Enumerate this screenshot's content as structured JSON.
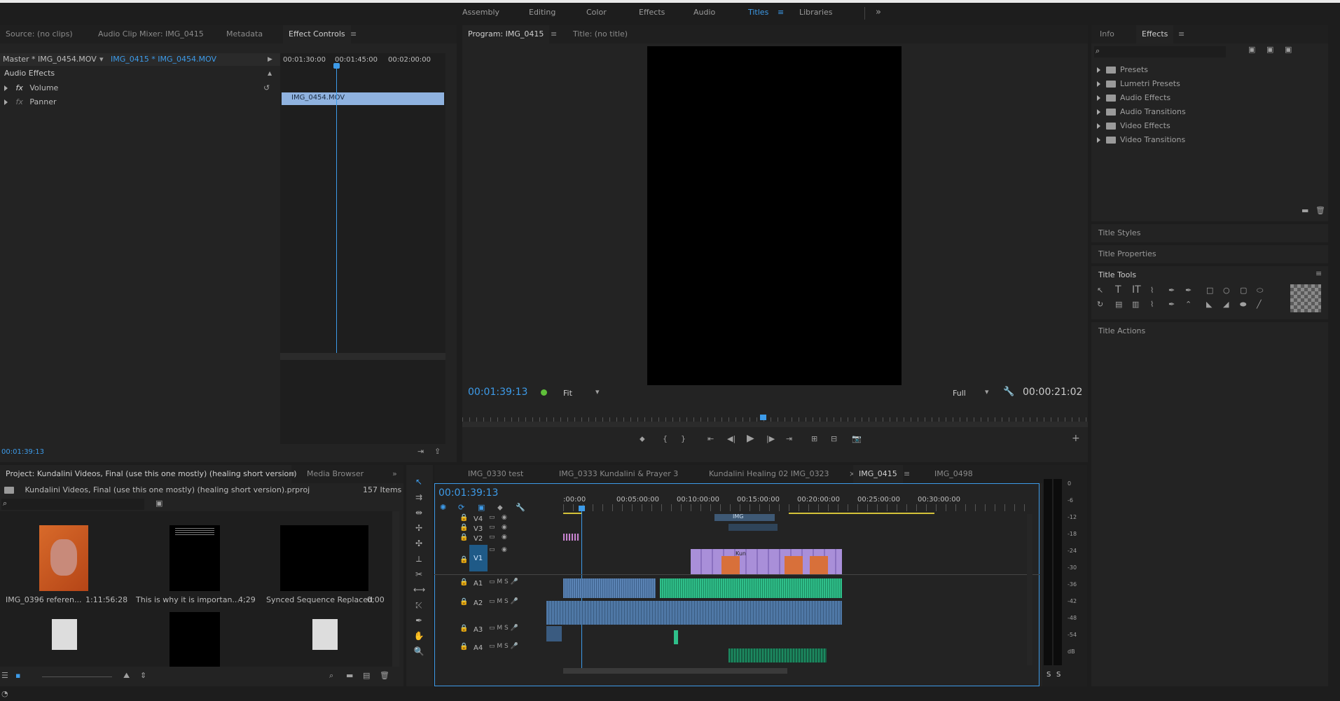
{
  "workspaces": [
    "Assembly",
    "Editing",
    "Color",
    "Effects",
    "Audio",
    "Titles",
    "Libraries"
  ],
  "active_workspace": "Titles",
  "source_panel": {
    "tabs": [
      "Source: (no clips)",
      "Audio Clip Mixer: IMG_0415",
      "Metadata",
      "Effect Controls"
    ],
    "master": "Master * IMG_0454.MOV",
    "sequence_clip": "IMG_0415 * IMG_0454.MOV",
    "section": "Audio Effects",
    "effects": [
      "Volume",
      "Panner"
    ],
    "ruler": [
      "00:01:30:00",
      "00:01:45:00",
      "00:02:00:00"
    ],
    "clip_name": "IMG_0454.MOV",
    "timecode": "00:01:39:13"
  },
  "program": {
    "tabs": [
      "Program: IMG_0415",
      "Title: (no title)"
    ],
    "timecode": "00:01:39:13",
    "fit": "Fit",
    "quality": "Full",
    "duration": "00:00:21:02"
  },
  "effects_panel": {
    "tabs": [
      "Info",
      "Effects"
    ],
    "items": [
      "Presets",
      "Lumetri Presets",
      "Audio Effects",
      "Audio Transitions",
      "Video Effects",
      "Video Transitions"
    ],
    "sections": [
      "Title Styles",
      "Title Properties",
      "Title Tools",
      "Title Actions"
    ]
  },
  "project": {
    "tabs": [
      "Project: Kundalini Videos, Final (use this one mostly) (healing short version)",
      "Media Browser"
    ],
    "file": "Kundalini Videos, Final (use this one mostly) (healing short version).prproj",
    "count": "157 Items",
    "items": [
      {
        "name": "IMG_0396 referen...",
        "dur": "1:11:56:28"
      },
      {
        "name": "This is why it is importan...",
        "dur": "4;29"
      },
      {
        "name": "Synced Sequence Replaced",
        "dur": "0;00"
      }
    ]
  },
  "timeline": {
    "tabs": [
      "IMG_0330 test",
      "IMG_0333 Kundalini & Prayer 3",
      "Kundalini Healing 02 IMG_0323",
      "IMG_0415",
      "IMG_0498"
    ],
    "active_tab": "IMG_0415",
    "timecode": "00:01:39:13",
    "ruler": [
      ":00:00",
      "00:05:00:00",
      "00:10:00:00",
      "00:15:00:00",
      "00:20:00:00",
      "00:25:00:00",
      "00:30:00:00"
    ],
    "video_tracks": [
      "V4",
      "V3",
      "V2",
      "V1"
    ],
    "audio_tracks": [
      "A1",
      "A2",
      "A3",
      "A4"
    ],
    "clip_label_img": "IMG",
    "clip_label_kun": "Kun"
  },
  "meter": {
    "scale": [
      "0",
      "-6",
      "-12",
      "-18",
      "-24",
      "-30",
      "-36",
      "-42",
      "-48",
      "-54",
      "dB"
    ],
    "solo": [
      "S",
      "S"
    ]
  }
}
